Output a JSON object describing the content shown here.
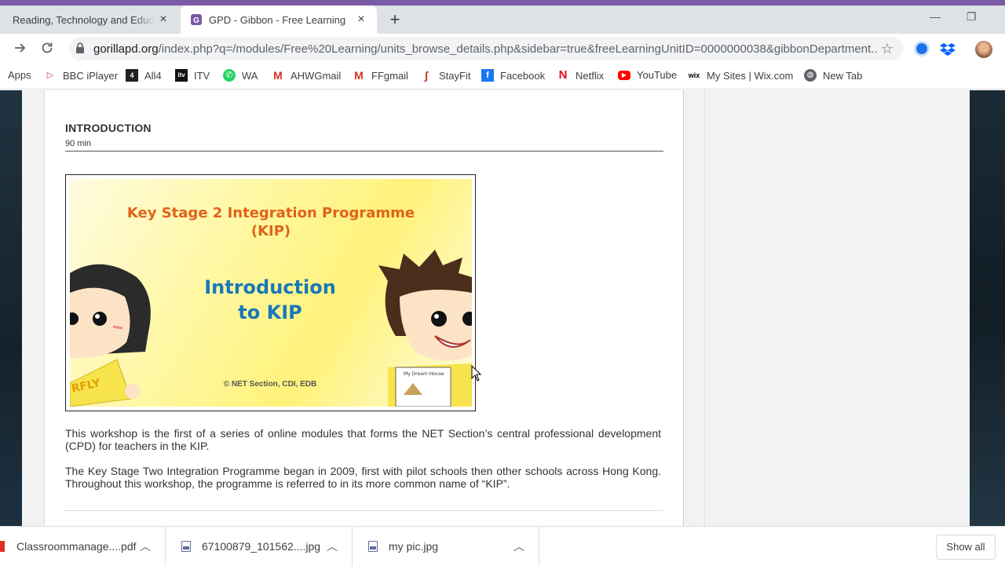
{
  "browser": {
    "tabs": [
      {
        "title": "Reading, Technology and Education",
        "close": "×"
      },
      {
        "title": "GPD - Gibbon - Free Learning",
        "close": "×",
        "favicon_letter": "G"
      }
    ],
    "new_tab": "+",
    "window_controls": {
      "minimize": "—",
      "restore": "❐"
    },
    "url_host": "gorillapd.org",
    "url_rest": "/index.php?q=/modules/Free%20Learning/units_browse_details.php&sidebar=true&freeLearningUnitID=0000000038&gibbonDepartment...",
    "bookmarks": [
      {
        "label": "Apps",
        "icon": "apps-grid-icon",
        "color": "#4285f4"
      },
      {
        "label": "BBC iPlayer",
        "icon": "bbc-iplayer-icon",
        "color": "#e2246f"
      },
      {
        "label": "All4",
        "icon": "all4-icon",
        "color": "#222222"
      },
      {
        "label": "ITV",
        "icon": "itv-icon",
        "color": "#111111"
      },
      {
        "label": "WA",
        "icon": "whatsapp-icon",
        "color": "#25d366"
      },
      {
        "label": "AHWGmail",
        "icon": "gmail-icon",
        "color": "#d93025"
      },
      {
        "label": "FFgmail",
        "icon": "gmail-icon",
        "color": "#d93025"
      },
      {
        "label": "StayFit",
        "icon": "stayfit-icon",
        "color": "#c0392b"
      },
      {
        "label": "Facebook",
        "icon": "facebook-icon",
        "color": "#1877f2"
      },
      {
        "label": "Netflix",
        "icon": "netflix-icon",
        "color": "#e50914"
      },
      {
        "label": "YouTube",
        "icon": "youtube-icon",
        "color": "#ff0000"
      },
      {
        "label": "My Sites | Wix.com",
        "icon": "wix-icon",
        "color": "#000000"
      },
      {
        "label": "New Tab",
        "icon": "globe-icon",
        "color": "#5f6368"
      }
    ]
  },
  "page": {
    "section_title": "INTRODUCTION",
    "duration": "90 min",
    "slide": {
      "title_line1": "Key Stage 2 Integration Programme",
      "title_line2": "(KIP)",
      "subtitle_line1": "Introduction",
      "subtitle_line2": "to KIP",
      "copyright": "© NET Section, CDI, EDB",
      "sign_text": "RFLY",
      "paper_text": "My Dream House"
    },
    "paragraph1": "This workshop is the first of a series of online modules that forms the NET Section’s central professional development (CPD) for teachers in the KIP.",
    "paragraph2": "The Key Stage Two Integration Programme began in 2009, first with pilot schools then other schools across Hong Kong. Throughout this workshop, the programme is referred to in its more common name of “KIP”."
  },
  "downloads": {
    "items": [
      {
        "filename": "Classroommanage....pdf"
      },
      {
        "filename": "67100879_101562....jpg"
      },
      {
        "filename": "my pic.jpg"
      }
    ],
    "show_all": "Show all"
  }
}
